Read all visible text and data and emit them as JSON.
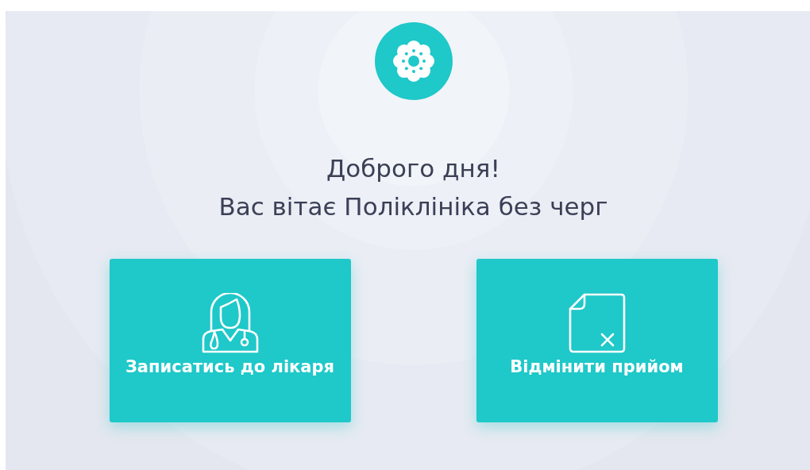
{
  "greeting": {
    "title": "Доброго дня!",
    "subtitle": "Вас вітає Поліклініка без черг"
  },
  "actions": [
    {
      "label": "Записатись до лікаря",
      "kind": "doctor"
    },
    {
      "label": "Відмінити прийом",
      "kind": "cancel"
    }
  ]
}
